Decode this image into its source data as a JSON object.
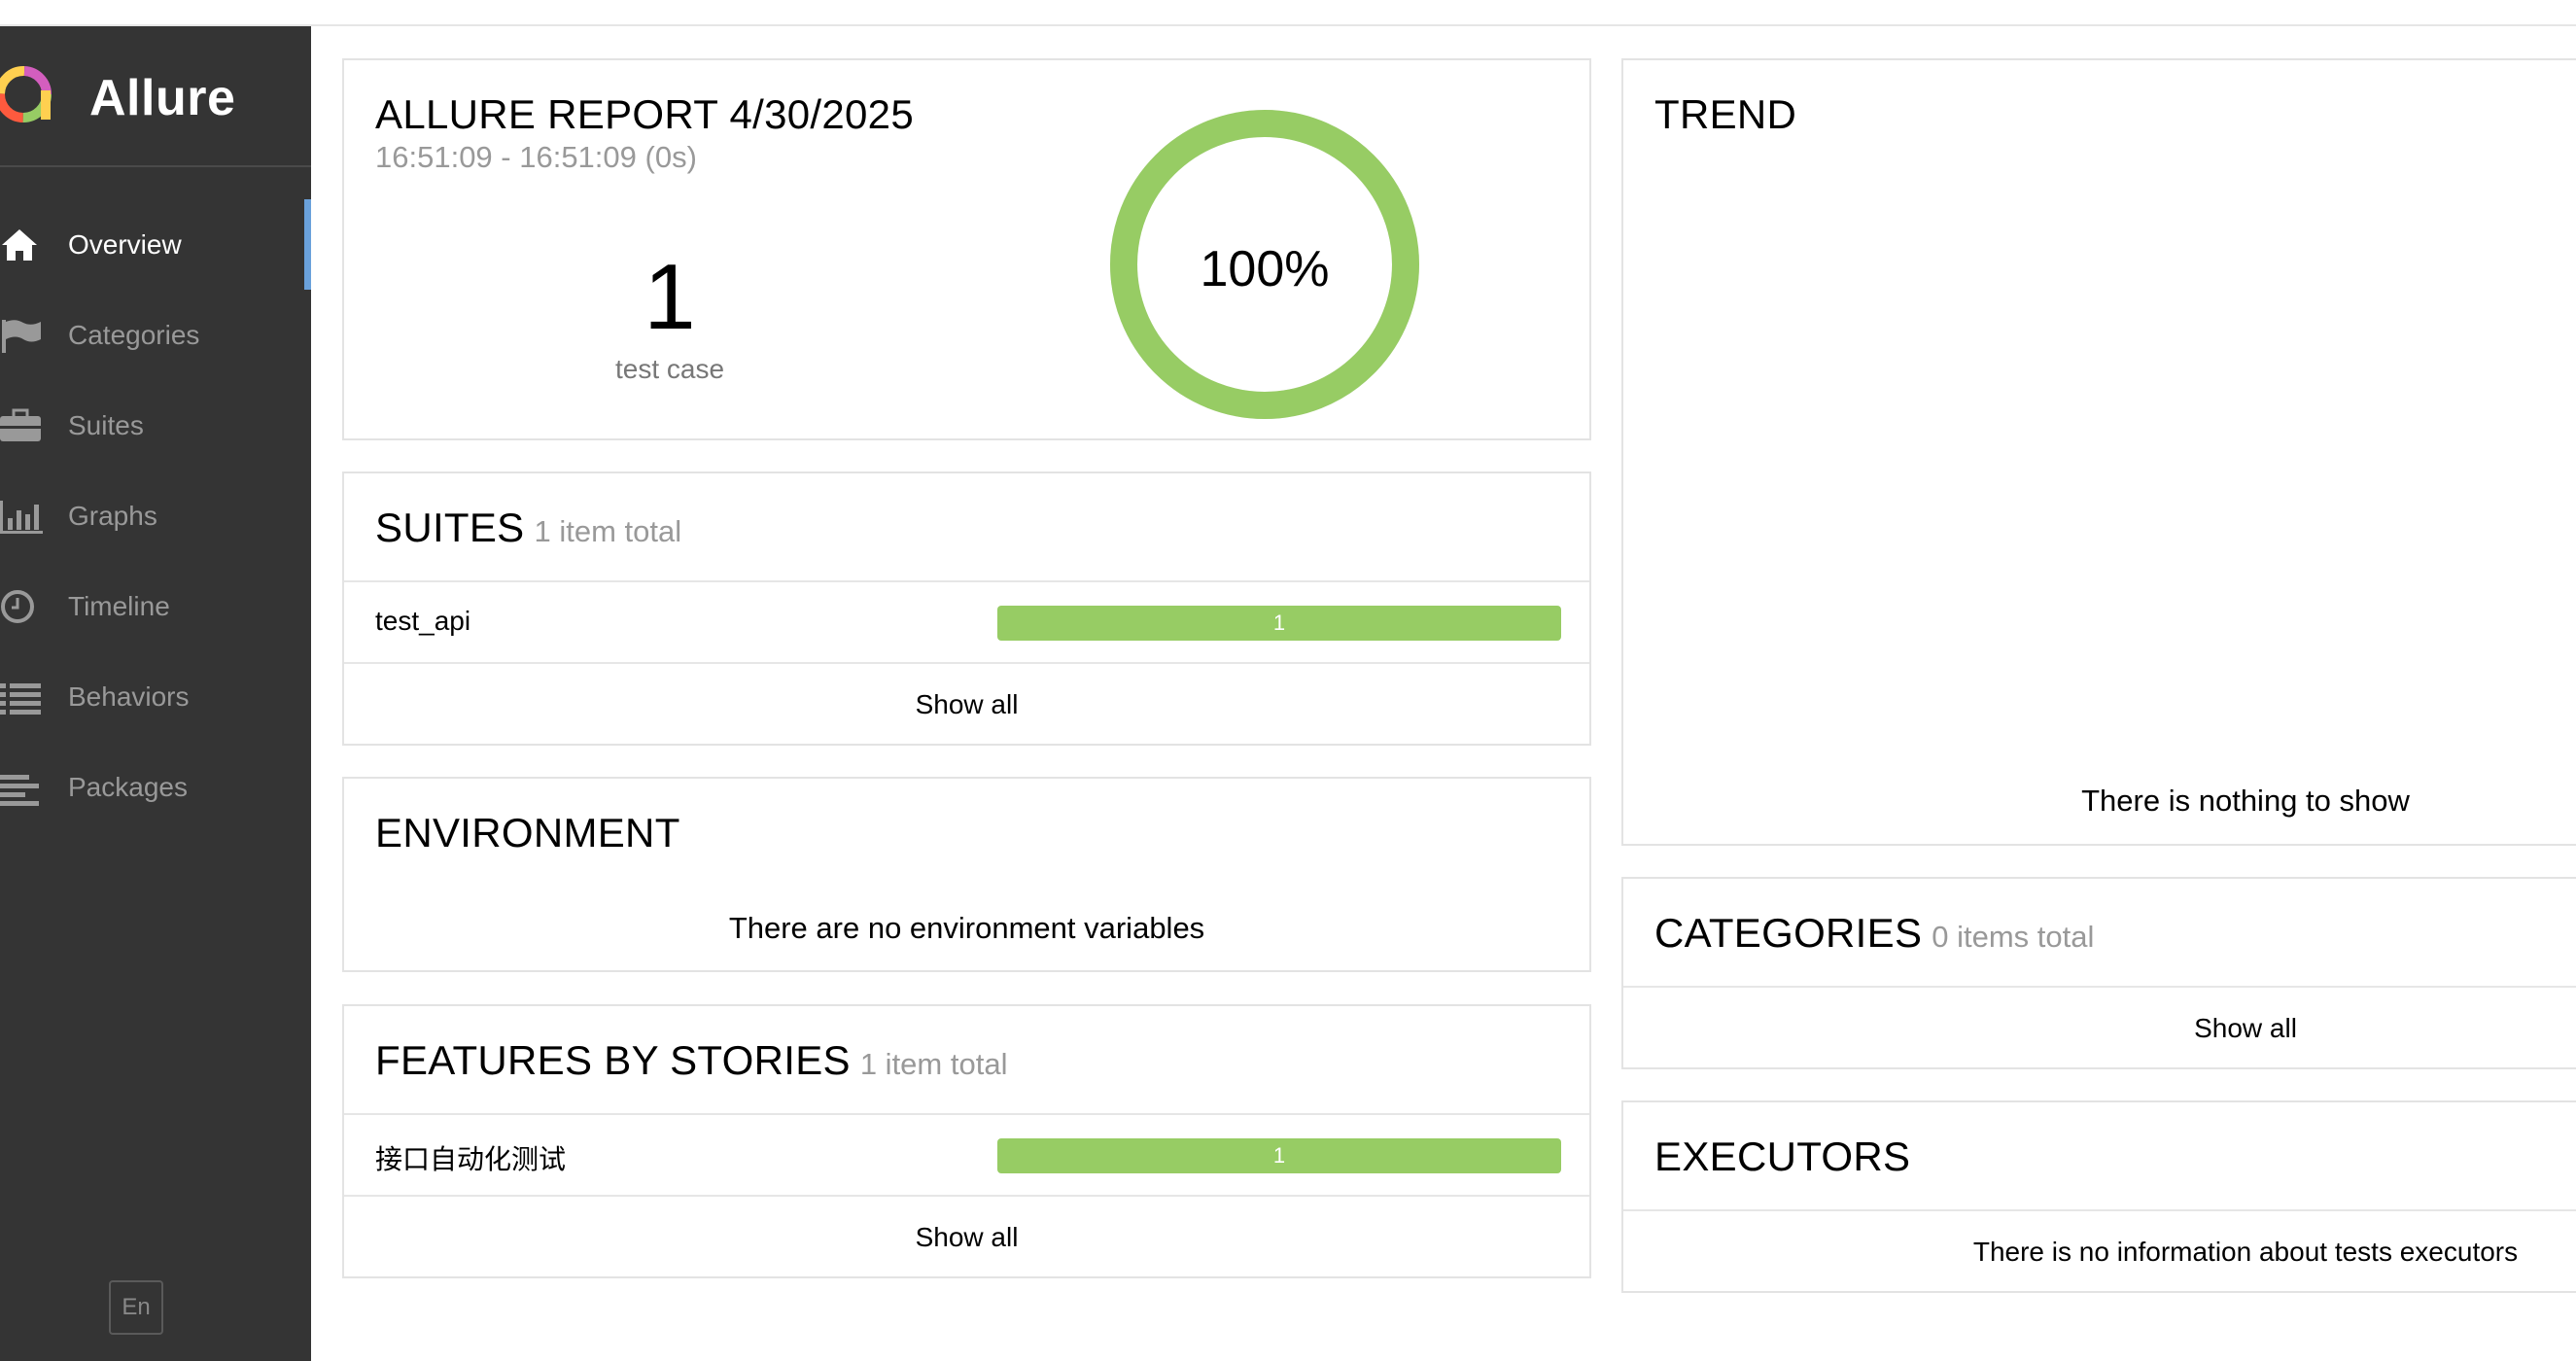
{
  "brand": {
    "name": "Allure",
    "lang": "En"
  },
  "sidebar": {
    "items": [
      {
        "label": "Overview",
        "icon": "home-icon",
        "active": true
      },
      {
        "label": "Categories",
        "icon": "flag-icon",
        "active": false
      },
      {
        "label": "Suites",
        "icon": "briefcase-icon",
        "active": false
      },
      {
        "label": "Graphs",
        "icon": "bar-chart-icon",
        "active": false
      },
      {
        "label": "Timeline",
        "icon": "clock-icon",
        "active": false
      },
      {
        "label": "Behaviors",
        "icon": "list-icon",
        "active": false
      },
      {
        "label": "Packages",
        "icon": "align-left-icon",
        "active": false
      }
    ]
  },
  "summary": {
    "title": "ALLURE REPORT 4/30/2025",
    "time_range": "16:51:09 - 16:51:09 (0s)",
    "test_count": "1",
    "test_count_label": "test case",
    "percent_label": "100%",
    "pass_fraction": 1.0
  },
  "suites": {
    "title": "SUITES",
    "count": "1 item total",
    "rows": [
      {
        "name": "test_api",
        "value": "1"
      }
    ],
    "show_all": "Show all"
  },
  "environment": {
    "title": "ENVIRONMENT",
    "message": "There are no environment variables"
  },
  "features": {
    "title": "FEATURES BY STORIES",
    "count": "1 item total",
    "rows": [
      {
        "name": "接口自动化测试",
        "value": "1"
      }
    ],
    "show_all": "Show all"
  },
  "trend": {
    "title": "TREND",
    "message": "There is nothing to show"
  },
  "categories": {
    "title": "CATEGORIES",
    "count": "0 items total",
    "show_all": "Show all"
  },
  "executors": {
    "title": "EXECUTORS",
    "message": "There is no information about tests executors"
  },
  "colors": {
    "passed": "#97cc64",
    "sidebar_bg": "#343434",
    "active_marker": "#6aa1db"
  }
}
